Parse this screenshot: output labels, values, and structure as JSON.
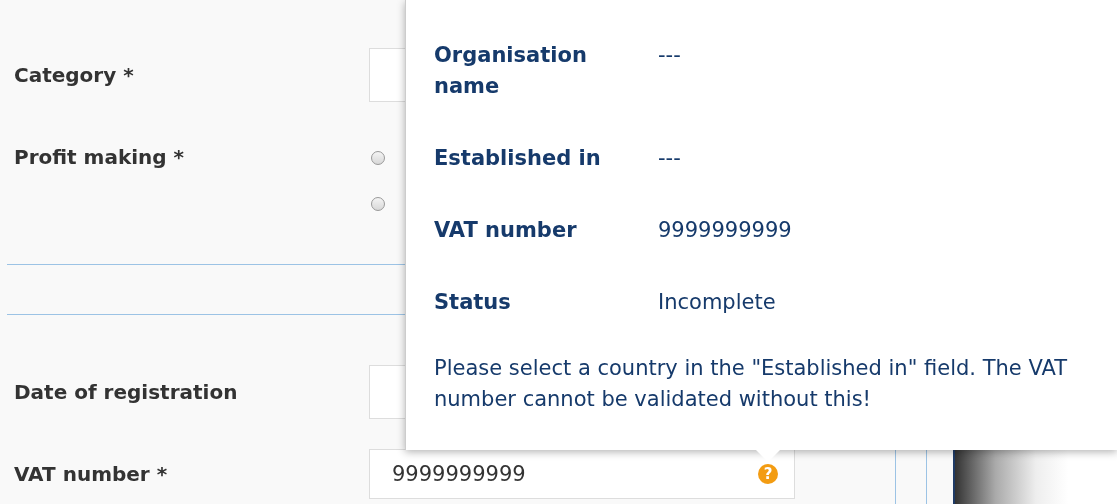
{
  "form": {
    "fields": [
      {
        "kind": "text",
        "label": "Category *"
      },
      {
        "kind": "radio",
        "label": "Profit making *",
        "options": [
          {
            "selected": false
          },
          {
            "selected": false
          }
        ]
      },
      {
        "kind": "divider"
      },
      {
        "kind": "text",
        "label": "Date of registration"
      },
      {
        "kind": "help",
        "label": "VAT number *",
        "value": "9999999999",
        "help_icon": "?"
      }
    ]
  },
  "popover": {
    "rows": [
      {
        "label": "Organisation name",
        "value": "---"
      },
      {
        "label": "Established in",
        "value": "---"
      },
      {
        "label": "VAT number",
        "value": "9999999999"
      },
      {
        "label": "Status",
        "value": "Incomplete"
      }
    ],
    "message": "Please select a country in the \"Established in\" field. The VAT number cannot be validated without this!"
  }
}
